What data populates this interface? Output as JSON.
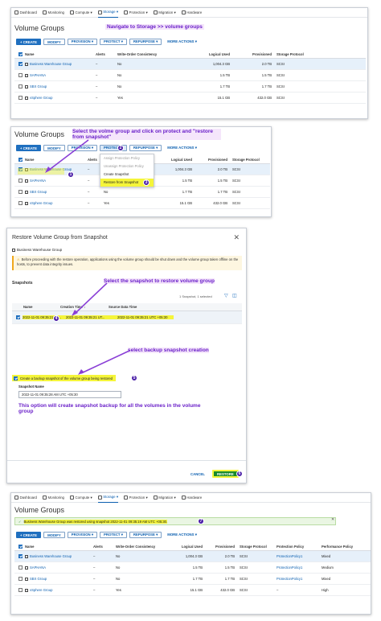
{
  "nav": {
    "items": [
      "Dashboard",
      "Monitoring",
      "Compute ▾",
      "Storage ▾",
      "Protection ▾",
      "Migration ▾",
      "Hardware"
    ],
    "active_index": 3
  },
  "page_title": "Volume Groups",
  "toolbar": {
    "create": "+ CREATE",
    "modify": "MODIFY",
    "provision": "PROVISION ▾",
    "protect": "PROTECT ▾",
    "repurpose": "REPURPOSE ▾",
    "more": "MORE ACTIONS ▾"
  },
  "table": {
    "headers": [
      "Name",
      "Alerts",
      "Write-Order Consistency",
      "Logical Used",
      "Provisioned",
      "Storage Protocol"
    ],
    "rows": [
      {
        "name": "Business Warehouse Group",
        "alerts": "–",
        "woc": "No",
        "logical": "1,004.3 GB",
        "provisioned": "2.0 TB",
        "protocol": "SCSI"
      },
      {
        "name": "SAPHANA",
        "alerts": "–",
        "woc": "No",
        "logical": "1.5 TB",
        "provisioned": "1.5 TB",
        "protocol": "SCSI"
      },
      {
        "name": "SBX Group",
        "alerts": "–",
        "woc": "No",
        "logical": "1.7 TB",
        "provisioned": "1.7 TB",
        "protocol": "SCSI"
      },
      {
        "name": "vSphere Group",
        "alerts": "–",
        "woc": "Yes",
        "logical": "15.1 GB",
        "provisioned": "432.0 GB",
        "protocol": "SCSI"
      }
    ]
  },
  "table4": {
    "headers": [
      "Name",
      "Alerts",
      "Write-Order Consistency",
      "Logical Used",
      "Provisioned",
      "Storage Protocol",
      "Protection Policy",
      "Performance Policy"
    ],
    "rows": [
      {
        "name": "Business Warehouse Group",
        "alerts": "–",
        "woc": "No",
        "logical": "1,004.3 GB",
        "provisioned": "2.0 TB",
        "protocol": "SCSI",
        "policy": "ProtectionPolicy1",
        "perf": "Mixed"
      },
      {
        "name": "SAPHANA",
        "alerts": "–",
        "woc": "No",
        "logical": "1.5 TB",
        "provisioned": "1.5 TB",
        "protocol": "SCSI",
        "policy": "ProtectionPolicy1",
        "perf": "Medium"
      },
      {
        "name": "SBX Group",
        "alerts": "–",
        "woc": "No",
        "logical": "1.7 TB",
        "provisioned": "1.7 TB",
        "protocol": "SCSI",
        "policy": "ProtectionPolicy1",
        "perf": "Mixed"
      },
      {
        "name": "vSphere Group",
        "alerts": "–",
        "woc": "Yes",
        "logical": "15.1 GB",
        "provisioned": "432.0 GB",
        "protocol": "SCSI",
        "policy": "–",
        "perf": "High"
      }
    ]
  },
  "protect_menu": [
    "Assign Protection Policy",
    "Unassign Protection Policy",
    "Create Snapshot",
    "Restore from Snapshot"
  ],
  "dialog": {
    "title": "Restore Volume Group from Snapshot",
    "group": "Business Warehouse Group",
    "warning": "Before proceeding with the restore operation, applications using the volume group should be shut down and the volume group taken offline on the hosts, to prevent data integrity issues.",
    "snapshots_label": "Snapshots",
    "count": "1 Snapshot, 1 selected",
    "snap_headers": [
      "Name",
      "Creation Time ↓",
      "Source Data Time"
    ],
    "snap_row": {
      "name": "2022-11-01 09:35:21 UT...",
      "created": "2022-11-01 09:35:21 UT...",
      "source": "2022-11-01 09:35:21 UTC +05:30"
    },
    "backup_checkbox": "Create a backup snapshot of the volume group being restored",
    "snapshot_name_label": "Snapshot Name",
    "snapshot_name_value": "2022-11-01 09:35:28 AM UTC +05:30",
    "cancel": "CANCEL",
    "restore": "RESTORE"
  },
  "success_msg": "Business Warehouse Group was restored using snapshot 2022-11-01 09:35:19 AM UTC +05:30.",
  "annotations": {
    "a1": "Navigate to Storage >> volume groups",
    "a2": "Select the volme group and click on protect and \"restore from snapshot\"",
    "a3": "Select the snapshot to restore volume group",
    "a4": "select backup snapshot creation",
    "a5": "This option will create snapshot backup for all the volumes in the volume group"
  },
  "step_numbers": [
    "1",
    "2",
    "3",
    "4",
    "5",
    "6",
    "7"
  ],
  "colors": {
    "accent": "#1f6fbf",
    "annotation": "#6b21c9",
    "highlight": "#f5f53a",
    "step_badge": "#4b1fa8"
  }
}
